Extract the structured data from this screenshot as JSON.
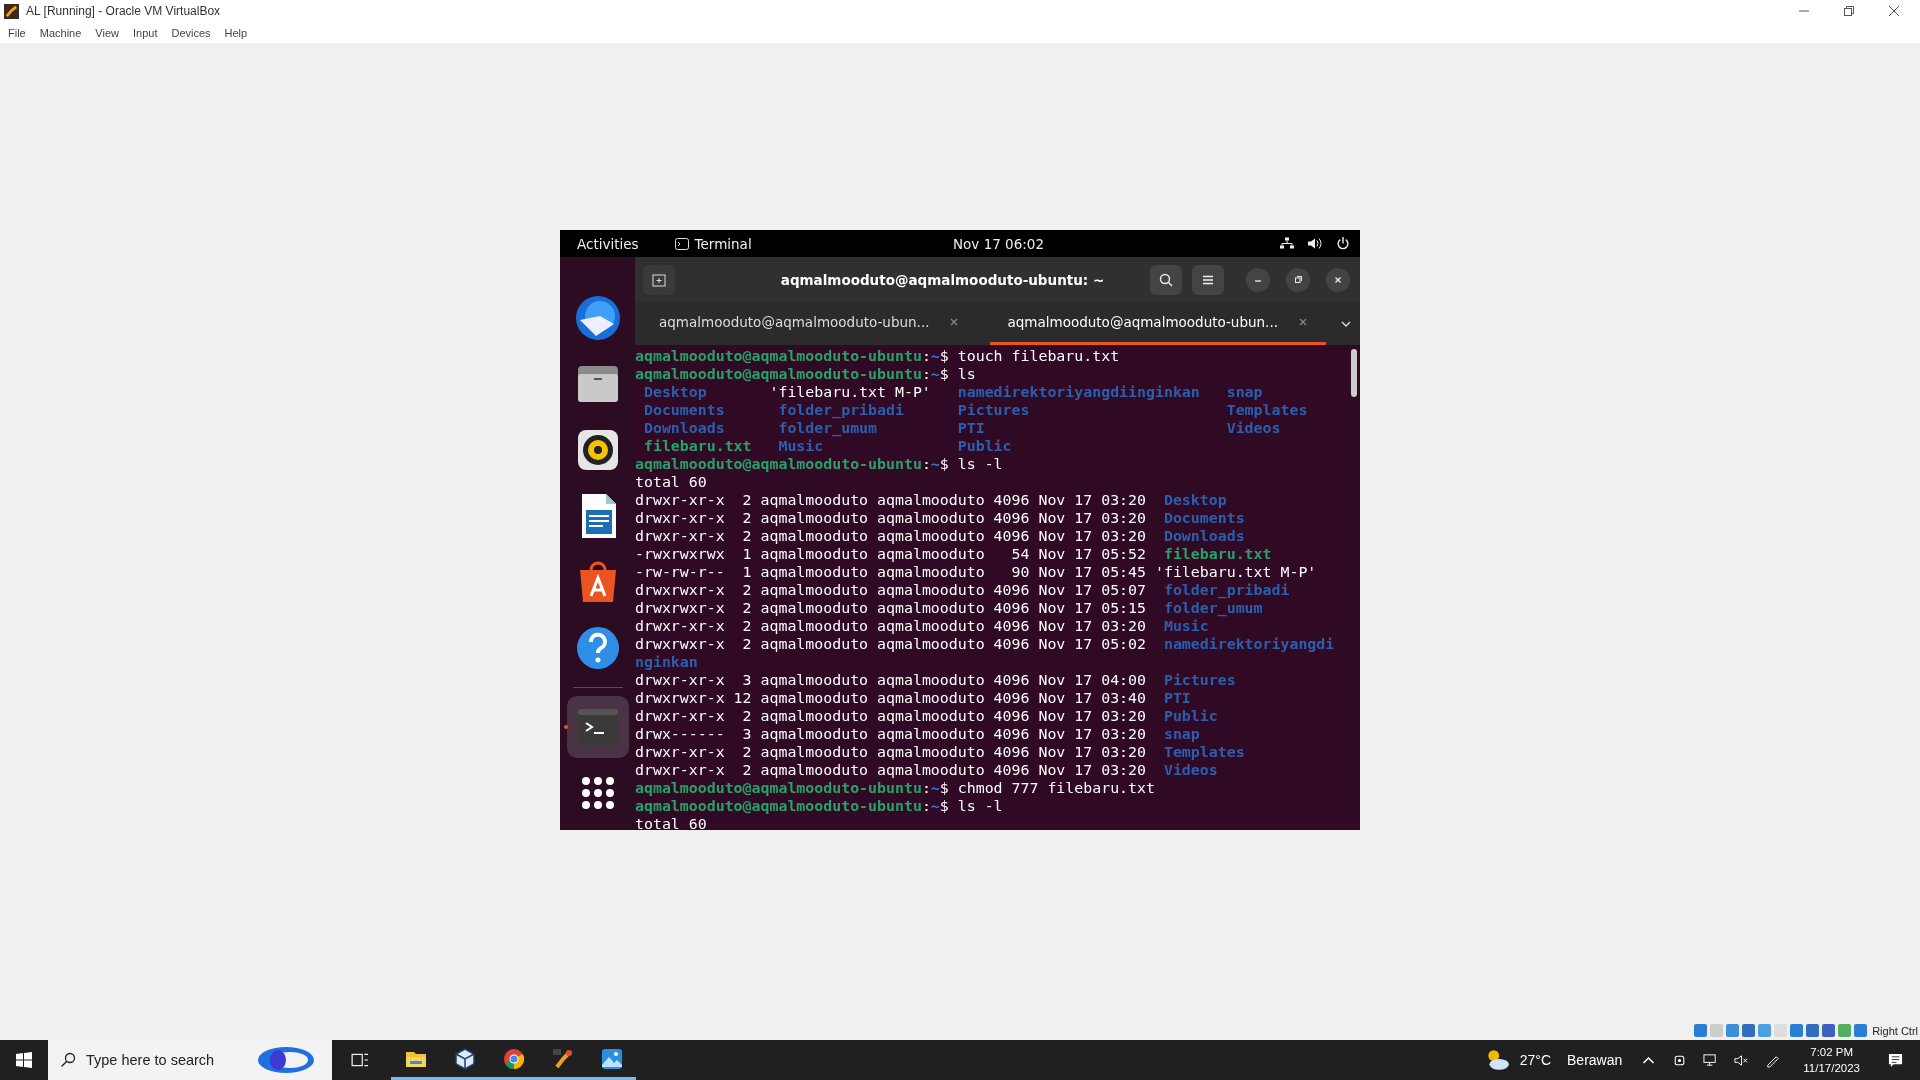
{
  "window": {
    "title": "AL [Running] - Oracle VM VirtualBox",
    "menu": [
      "File",
      "Machine",
      "View",
      "Input",
      "Devices",
      "Help"
    ]
  },
  "guest": {
    "top_bar": {
      "activities": "Activities",
      "app": "Terminal",
      "clock": "Nov 17  06:02"
    },
    "dock": [
      {
        "kind": "mail",
        "running": false
      },
      {
        "kind": "files",
        "running": false
      },
      {
        "kind": "music",
        "running": false
      },
      {
        "kind": "writer",
        "running": false
      },
      {
        "kind": "store",
        "running": false
      },
      {
        "kind": "help",
        "running": false
      },
      {
        "kind": "terminal",
        "running": true
      },
      {
        "kind": "apps",
        "running": false
      }
    ],
    "terminal": {
      "title": "aqmalmooduto@aqmalmooduto-ubuntu: ~",
      "tabs": [
        {
          "label": "aqmalmooduto@aqmalmooduto-ubun...",
          "selected": false
        },
        {
          "label": "aqmalmooduto@aqmalmooduto-ubun...",
          "selected": true
        }
      ],
      "lines": [
        {
          "kind": "prompt",
          "user": "aqmalmooduto@aqmalmooduto-ubuntu",
          "separator": ":",
          "path": "~",
          "sign": "$",
          "command": "touch filebaru.txt"
        },
        {
          "kind": "prompt",
          "user": "aqmalmooduto@aqmalmooduto-ubuntu",
          "separator": ":",
          "path": "~",
          "sign": "$",
          "command": "ls"
        },
        {
          "kind": "columns",
          "cells": [
            {
              "text": " Desktop",
              "kind": "dir"
            },
            {
              "text": "'filebaru.txt M-P'",
              "kind": "plain"
            },
            {
              "text": " namedirektoriyangdiinginkan",
              "kind": "dir"
            },
            {
              "text": " snap",
              "kind": "dir"
            }
          ]
        },
        {
          "kind": "columns",
          "cells": [
            {
              "text": " Documents",
              "kind": "dir"
            },
            {
              "text": " folder_pribadi",
              "kind": "dir"
            },
            {
              "text": " Pictures",
              "kind": "dir"
            },
            {
              "text": " Templates",
              "kind": "dir"
            }
          ]
        },
        {
          "kind": "columns",
          "cells": [
            {
              "text": " Downloads",
              "kind": "dir"
            },
            {
              "text": " folder_umum",
              "kind": "dir"
            },
            {
              "text": " PTI",
              "kind": "dir"
            },
            {
              "text": " Videos",
              "kind": "dir"
            }
          ]
        },
        {
          "kind": "columns",
          "cells": [
            {
              "text": " filebaru.txt",
              "kind": "exec"
            },
            {
              "text": " Music",
              "kind": "dir"
            },
            {
              "text": " Public",
              "kind": "dir"
            }
          ]
        },
        {
          "kind": "prompt",
          "user": "aqmalmooduto@aqmalmooduto-ubuntu",
          "separator": ":",
          "path": "~",
          "sign": "$",
          "command": "ls -l"
        },
        {
          "kind": "output",
          "text": "total 60"
        },
        {
          "kind": "entry",
          "text": "drwxr-xr-x  2 aqmalmooduto aqmalmooduto 4096 Nov 17 03:20",
          "file": {
            "text": " Desktop",
            "kind": "dir"
          }
        },
        {
          "kind": "entry",
          "text": "drwxr-xr-x  2 aqmalmooduto aqmalmooduto 4096 Nov 17 03:20",
          "file": {
            "text": " Documents",
            "kind": "dir"
          }
        },
        {
          "kind": "entry",
          "text": "drwxr-xr-x  2 aqmalmooduto aqmalmooduto 4096 Nov 17 03:20",
          "file": {
            "text": " Downloads",
            "kind": "dir"
          }
        },
        {
          "kind": "entry",
          "text": "-rwxrwxrwx  1 aqmalmooduto aqmalmooduto   54 Nov 17 05:52",
          "file": {
            "text": " filebaru.txt",
            "kind": "exec"
          }
        },
        {
          "kind": "entry",
          "text": "-rw-rw-r--  1 aqmalmooduto aqmalmooduto   90 Nov 17 05:45",
          "file": {
            "text": "'filebaru.txt M-P'",
            "kind": "plain"
          }
        },
        {
          "kind": "entry",
          "text": "drwxrwxr-x  2 aqmalmooduto aqmalmooduto 4096 Nov 17 05:07",
          "file": {
            "text": " folder_pribadi",
            "kind": "dir"
          }
        },
        {
          "kind": "entry",
          "text": "drwxrwxr-x  2 aqmalmooduto aqmalmooduto 4096 Nov 17 05:15",
          "file": {
            "text": " folder_umum",
            "kind": "dir"
          }
        },
        {
          "kind": "entry",
          "text": "drwxr-xr-x  2 aqmalmooduto aqmalmooduto 4096 Nov 17 03:20",
          "file": {
            "text": " Music",
            "kind": "dir"
          }
        },
        {
          "kind": "entry",
          "text": "drwxrwxr-x  2 aqmalmooduto aqmalmooduto 4096 Nov 17 05:02",
          "file": {
            "text": " namedirektoriyangdi",
            "kind": "dir"
          }
        },
        {
          "kind": "wrap",
          "file": {
            "text": "nginkan",
            "kind": "dir"
          }
        },
        {
          "kind": "entry",
          "text": "drwxr-xr-x  3 aqmalmooduto aqmalmooduto 4096 Nov 17 04:00",
          "file": {
            "text": " Pictures",
            "kind": "dir"
          }
        },
        {
          "kind": "entry",
          "text": "drwxrwxr-x 12 aqmalmooduto aqmalmooduto 4096 Nov 17 03:40",
          "file": {
            "text": " PTI",
            "kind": "dir"
          }
        },
        {
          "kind": "entry",
          "text": "drwxr-xr-x  2 aqmalmooduto aqmalmooduto 4096 Nov 17 03:20",
          "file": {
            "text": " Public",
            "kind": "dir"
          }
        },
        {
          "kind": "entry",
          "text": "drwx------  3 aqmalmooduto aqmalmooduto 4096 Nov 17 03:20",
          "file": {
            "text": " snap",
            "kind": "dir"
          }
        },
        {
          "kind": "entry",
          "text": "drwxr-xr-x  2 aqmalmooduto aqmalmooduto 4096 Nov 17 03:20",
          "file": {
            "text": " Templates",
            "kind": "dir"
          }
        },
        {
          "kind": "entry",
          "text": "drwxr-xr-x  2 aqmalmooduto aqmalmooduto 4096 Nov 17 03:20",
          "file": {
            "text": " Videos",
            "kind": "dir"
          }
        },
        {
          "kind": "prompt",
          "user": "aqmalmooduto@aqmalmooduto-ubuntu",
          "separator": ":",
          "path": "~",
          "sign": "$",
          "command": "chmod 777 filebaru.txt"
        },
        {
          "kind": "prompt",
          "user": "aqmalmooduto@aqmalmooduto-ubuntu",
          "separator": ":",
          "path": "~",
          "sign": "$",
          "command": "ls -l"
        },
        {
          "kind": "output",
          "text": "total 60"
        }
      ]
    }
  },
  "vm_status": {
    "host_key": "Right Ctrl"
  },
  "taskbar": {
    "search": {
      "placeholder": "Type here to search"
    },
    "apps": [
      {
        "kind": "folder",
        "running": true
      },
      {
        "kind": "cube",
        "running": true
      },
      {
        "kind": "browser",
        "running": true
      },
      {
        "kind": "tool",
        "running": true
      },
      {
        "kind": "photos",
        "running": true
      }
    ],
    "weather": {
      "temp": "27°C",
      "condition": "Berawan"
    },
    "time": "7:02 PM",
    "date": "11/17/2023"
  }
}
